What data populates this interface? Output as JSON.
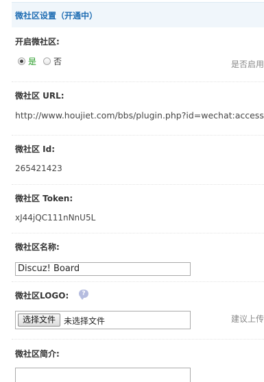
{
  "section": {
    "title": "微社区设置（开通中）"
  },
  "enable": {
    "label": "开启微社区:",
    "options": [
      {
        "label": "是",
        "checked": true
      },
      {
        "label": "否",
        "checked": false
      }
    ],
    "hint": "是否启用"
  },
  "url": {
    "label": "微社区 URL:",
    "value": "http://www.houjiet.com/bbs/plugin.php?id=wechat:access"
  },
  "site_id": {
    "label": "微社区 Id:",
    "value": "265421423"
  },
  "token": {
    "label": "微社区 Token:",
    "value": "xJ44jQC111nNnU5L"
  },
  "name": {
    "label": "微社区名称:",
    "value": "Discuz! Board"
  },
  "logo": {
    "label": "微社区LOGO:",
    "help_icon": "question-bubble-icon",
    "help_glyph": "?",
    "file_button": "选择文件",
    "file_status": "未选择文件",
    "hint": "建议上传"
  },
  "intro": {
    "label": "微社区简介:",
    "value": ""
  },
  "colors": {
    "header_bg": "#f0f6fb",
    "header_text": "#1f6db3",
    "checked_label": "#229922",
    "hint_text": "#888888"
  }
}
